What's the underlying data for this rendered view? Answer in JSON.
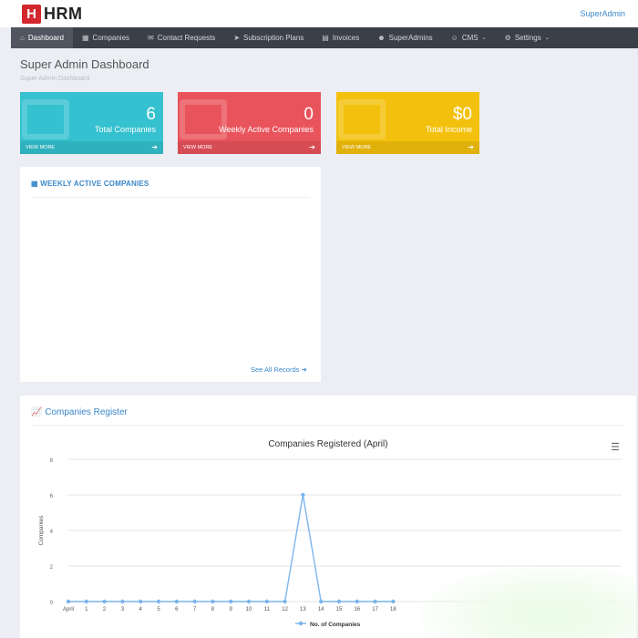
{
  "app": {
    "logo_letter": "H",
    "logo_text": "HRM",
    "user": "SuperAdmin"
  },
  "nav": [
    {
      "icon": "⌂",
      "label": "Dashboard",
      "active": true
    },
    {
      "icon": "▦",
      "label": "Companies"
    },
    {
      "icon": "✉",
      "label": "Contact Requests"
    },
    {
      "icon": "➤",
      "label": "Subscription Plans"
    },
    {
      "icon": "▤",
      "label": "Invoices"
    },
    {
      "icon": "☻",
      "label": "SuperAdmins"
    },
    {
      "icon": "☺",
      "label": "CMS",
      "caret": "⌄"
    },
    {
      "icon": "⚙",
      "label": "Settings",
      "caret": "⌄"
    }
  ],
  "page": {
    "title": "Super Admin Dashboard",
    "breadcrumb": "Super Admin Dashboard"
  },
  "stats": [
    {
      "value": "6",
      "label": "Total Companies",
      "more": "VIEW MORE",
      "color": "#35c1cf"
    },
    {
      "value": "0",
      "label": "Weekly Active Companies",
      "more": "VIEW MORE",
      "color": "#e9535c"
    },
    {
      "value": "$0",
      "label": "Total Income",
      "more": "VIEW MORE",
      "color": "#f3c10d"
    }
  ],
  "weekly": {
    "title": "WEEKLY ACTIVE COMPANIES",
    "see_all": "See All Records"
  },
  "register": {
    "title": "Companies Register"
  },
  "chart_data": {
    "type": "line",
    "title": "Companies Registered (April)",
    "xlabel": "",
    "ylabel": "Companies",
    "categories": [
      "April",
      "1",
      "2",
      "3",
      "4",
      "5",
      "6",
      "7",
      "8",
      "9",
      "10",
      "11",
      "12",
      "13",
      "14",
      "15",
      "16",
      "17",
      "18"
    ],
    "series": [
      {
        "name": "No. of Companies",
        "values": [
          0,
          0,
          0,
          0,
          0,
          0,
          0,
          0,
          0,
          0,
          0,
          0,
          0,
          6,
          0,
          0,
          0,
          0,
          0
        ],
        "color": "#7cb5ec"
      }
    ],
    "yticks": [
      0,
      2,
      4,
      6,
      8
    ],
    "ylim": [
      0,
      8
    ],
    "grid": true,
    "legend": "bottom"
  }
}
